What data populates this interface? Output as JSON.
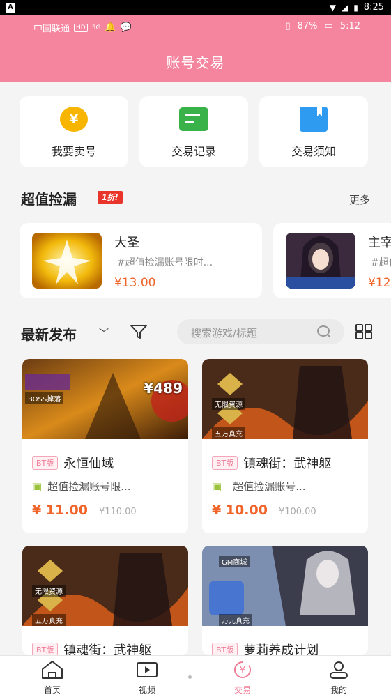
{
  "system_bar": {
    "app_badge": "A",
    "time": "8:25"
  },
  "status_bar": {
    "carrier": "中国联通",
    "hd": "HD",
    "net": "5G",
    "battery": "87%",
    "time": "5:12"
  },
  "header": {
    "title": "账号交易"
  },
  "quick_actions": [
    {
      "label": "我要卖号",
      "icon": "coin-yen-icon",
      "glyph": "¥"
    },
    {
      "label": "交易记录",
      "icon": "record-icon"
    },
    {
      "label": "交易须知",
      "icon": "notice-book-icon"
    }
  ],
  "deals_section": {
    "title": "超值捡漏",
    "badge": "1折!",
    "more": "更多"
  },
  "deals": [
    {
      "name": "大圣",
      "desc": "#超值捡漏账号限时...",
      "price": "¥13.00"
    },
    {
      "name": "主宰",
      "desc": "#超值",
      "price": "¥12"
    }
  ],
  "filter": {
    "latest": "最新发布",
    "chevron": "﹀",
    "search_placeholder": "搜索游戏/标题"
  },
  "games": [
    {
      "tag": "BT版",
      "name": "永恒仙域",
      "desc": "超值捡漏账号限...",
      "price": "¥ 11.00",
      "old_price": "¥110.00",
      "cover_text": "BOSS掉落",
      "cover_price": "¥489"
    },
    {
      "tag": "BT版",
      "name": "镇魂街：武神躯",
      "desc": "超值捡漏账号...",
      "price": "¥ 10.00",
      "old_price": "¥100.00",
      "cover_text": "无限资源",
      "cover_text2": "五万真充"
    },
    {
      "tag": "BT版",
      "name": "镇魂街：武神躯",
      "cover_text": "无限资源",
      "cover_text2": "五万真充"
    },
    {
      "tag": "BT版",
      "name": "萝莉养成计划",
      "cover_text": "GM商城",
      "cover_text2": "万元真充"
    }
  ],
  "tabs": [
    {
      "label": "首页",
      "icon": "home-icon"
    },
    {
      "label": "视频",
      "icon": "video-icon"
    },
    {
      "label": "交易",
      "icon": "trade-icon",
      "glyph": "¥"
    },
    {
      "label": "我的",
      "icon": "profile-icon"
    }
  ],
  "colors": {
    "header": "#f5859e",
    "accent": "#f07a95",
    "price": "#f0642a"
  }
}
